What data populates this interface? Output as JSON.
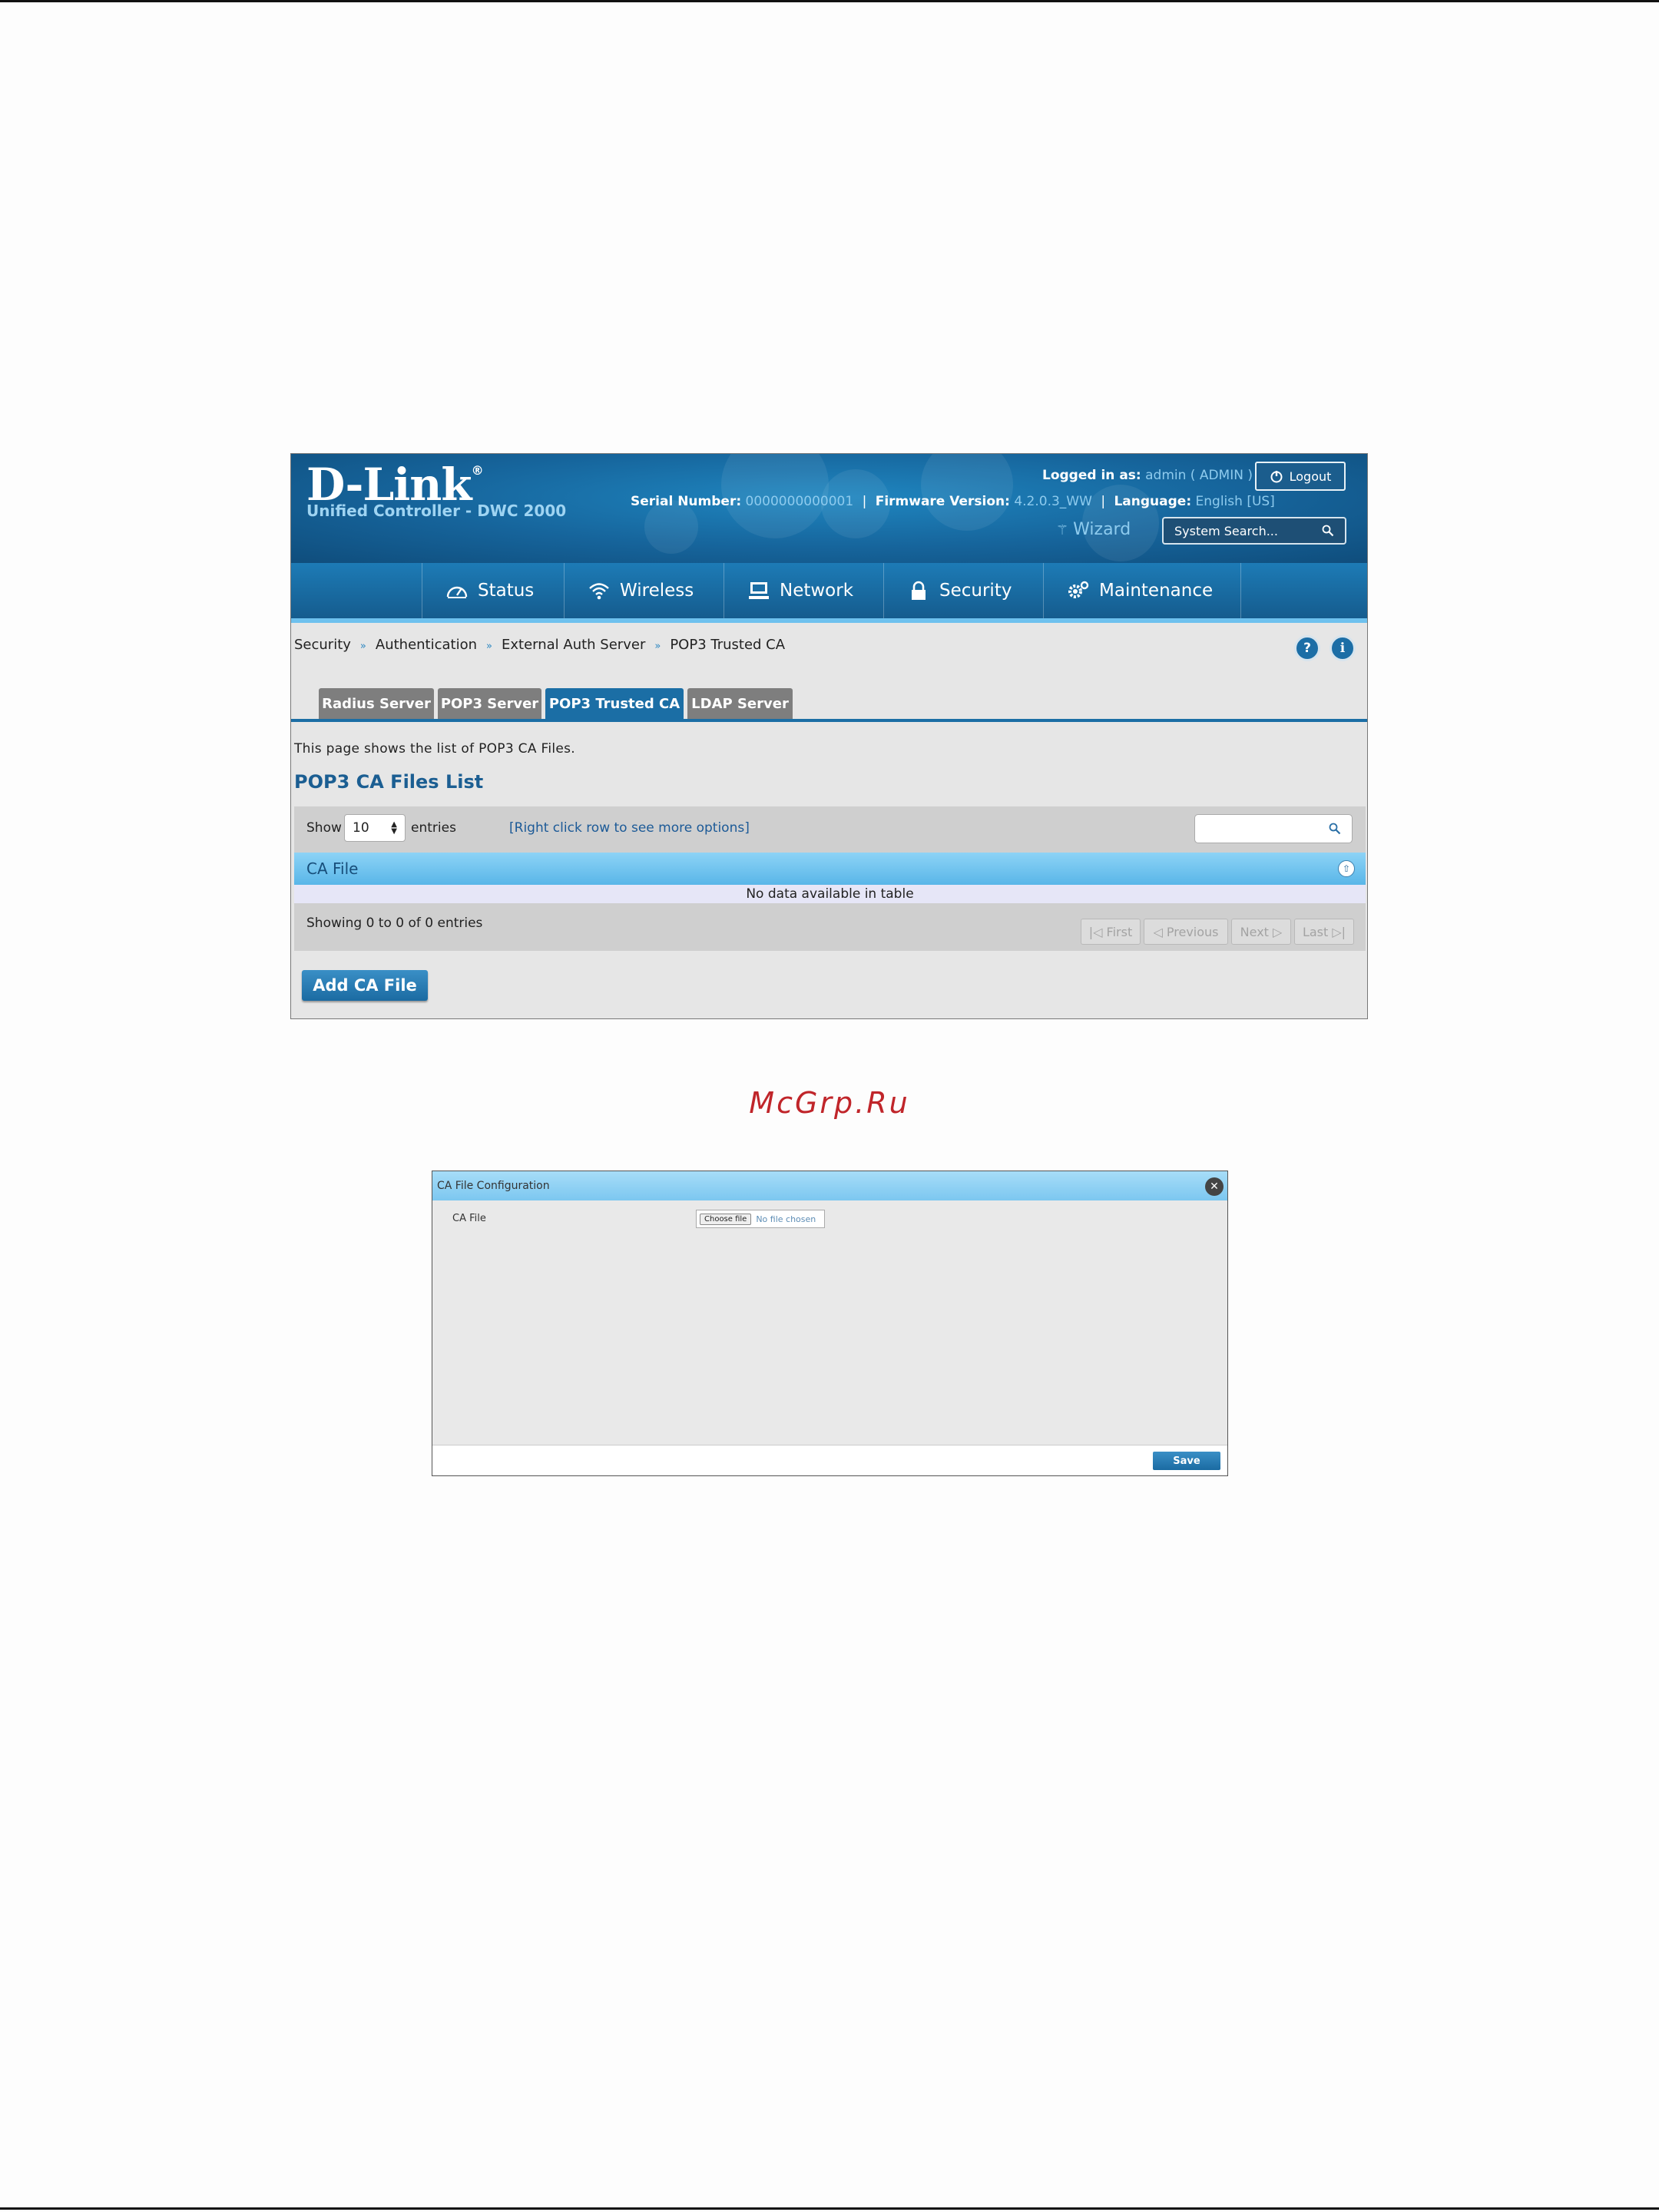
{
  "watermark": "McGrp.Ru",
  "header": {
    "brand": "D-Link",
    "registered": "®",
    "subtitle": "Unified Controller - DWC 2000",
    "serial_label": "Serial Number:",
    "serial_value": "0000000000001",
    "firmware_label": "Firmware Version:",
    "firmware_value": "4.2.0.3_WW",
    "language_label": "Language:",
    "language_value": "English [US]",
    "logged_in_label": "Logged in as:",
    "logged_in_value": "admin ( ADMIN )",
    "logout_label": "Logout",
    "wizard_label": "Wizard",
    "search_placeholder": "System Search..."
  },
  "nav": {
    "items": [
      {
        "label": "Status",
        "icon": "speedometer-icon"
      },
      {
        "label": "Wireless",
        "icon": "wifi-icon"
      },
      {
        "label": "Network",
        "icon": "network-icon"
      },
      {
        "label": "Security",
        "icon": "lock-icon"
      },
      {
        "label": "Maintenance",
        "icon": "gears-icon"
      }
    ]
  },
  "breadcrumb": {
    "items": [
      "Security",
      "Authentication",
      "External Auth Server",
      "POP3 Trusted CA"
    ],
    "separator": "»"
  },
  "help_icons": [
    "help-icon",
    "info-icon"
  ],
  "tabs": [
    {
      "label": "Radius Server",
      "active": false
    },
    {
      "label": "POP3 Server",
      "active": false
    },
    {
      "label": "POP3 Trusted CA",
      "active": true
    },
    {
      "label": "LDAP Server",
      "active": false
    }
  ],
  "page": {
    "description": "This page shows the list of POP3 CA Files.",
    "list_title": "POP3 CA Files List"
  },
  "table": {
    "show_label": "Show",
    "page_length": "10",
    "entries_label": "entries",
    "hint": "[Right click row to see more options]",
    "columns": [
      "CA File"
    ],
    "empty_message": "No data available in table",
    "showing": "Showing 0 to 0 of 0 entries",
    "pagination": [
      "First",
      "Previous",
      "Next",
      "Last"
    ]
  },
  "add_button": "Add CA File",
  "dialog": {
    "title": "CA File Configuration",
    "field_label": "CA File",
    "choose_file": "Choose file",
    "file_status": "No file chosen",
    "save_label": "Save"
  },
  "colors": {
    "header_blue": "#16649b",
    "accent_blue": "#1b6ea5",
    "table_header": "#59b6e8",
    "watermark_red": "#c0252a"
  }
}
